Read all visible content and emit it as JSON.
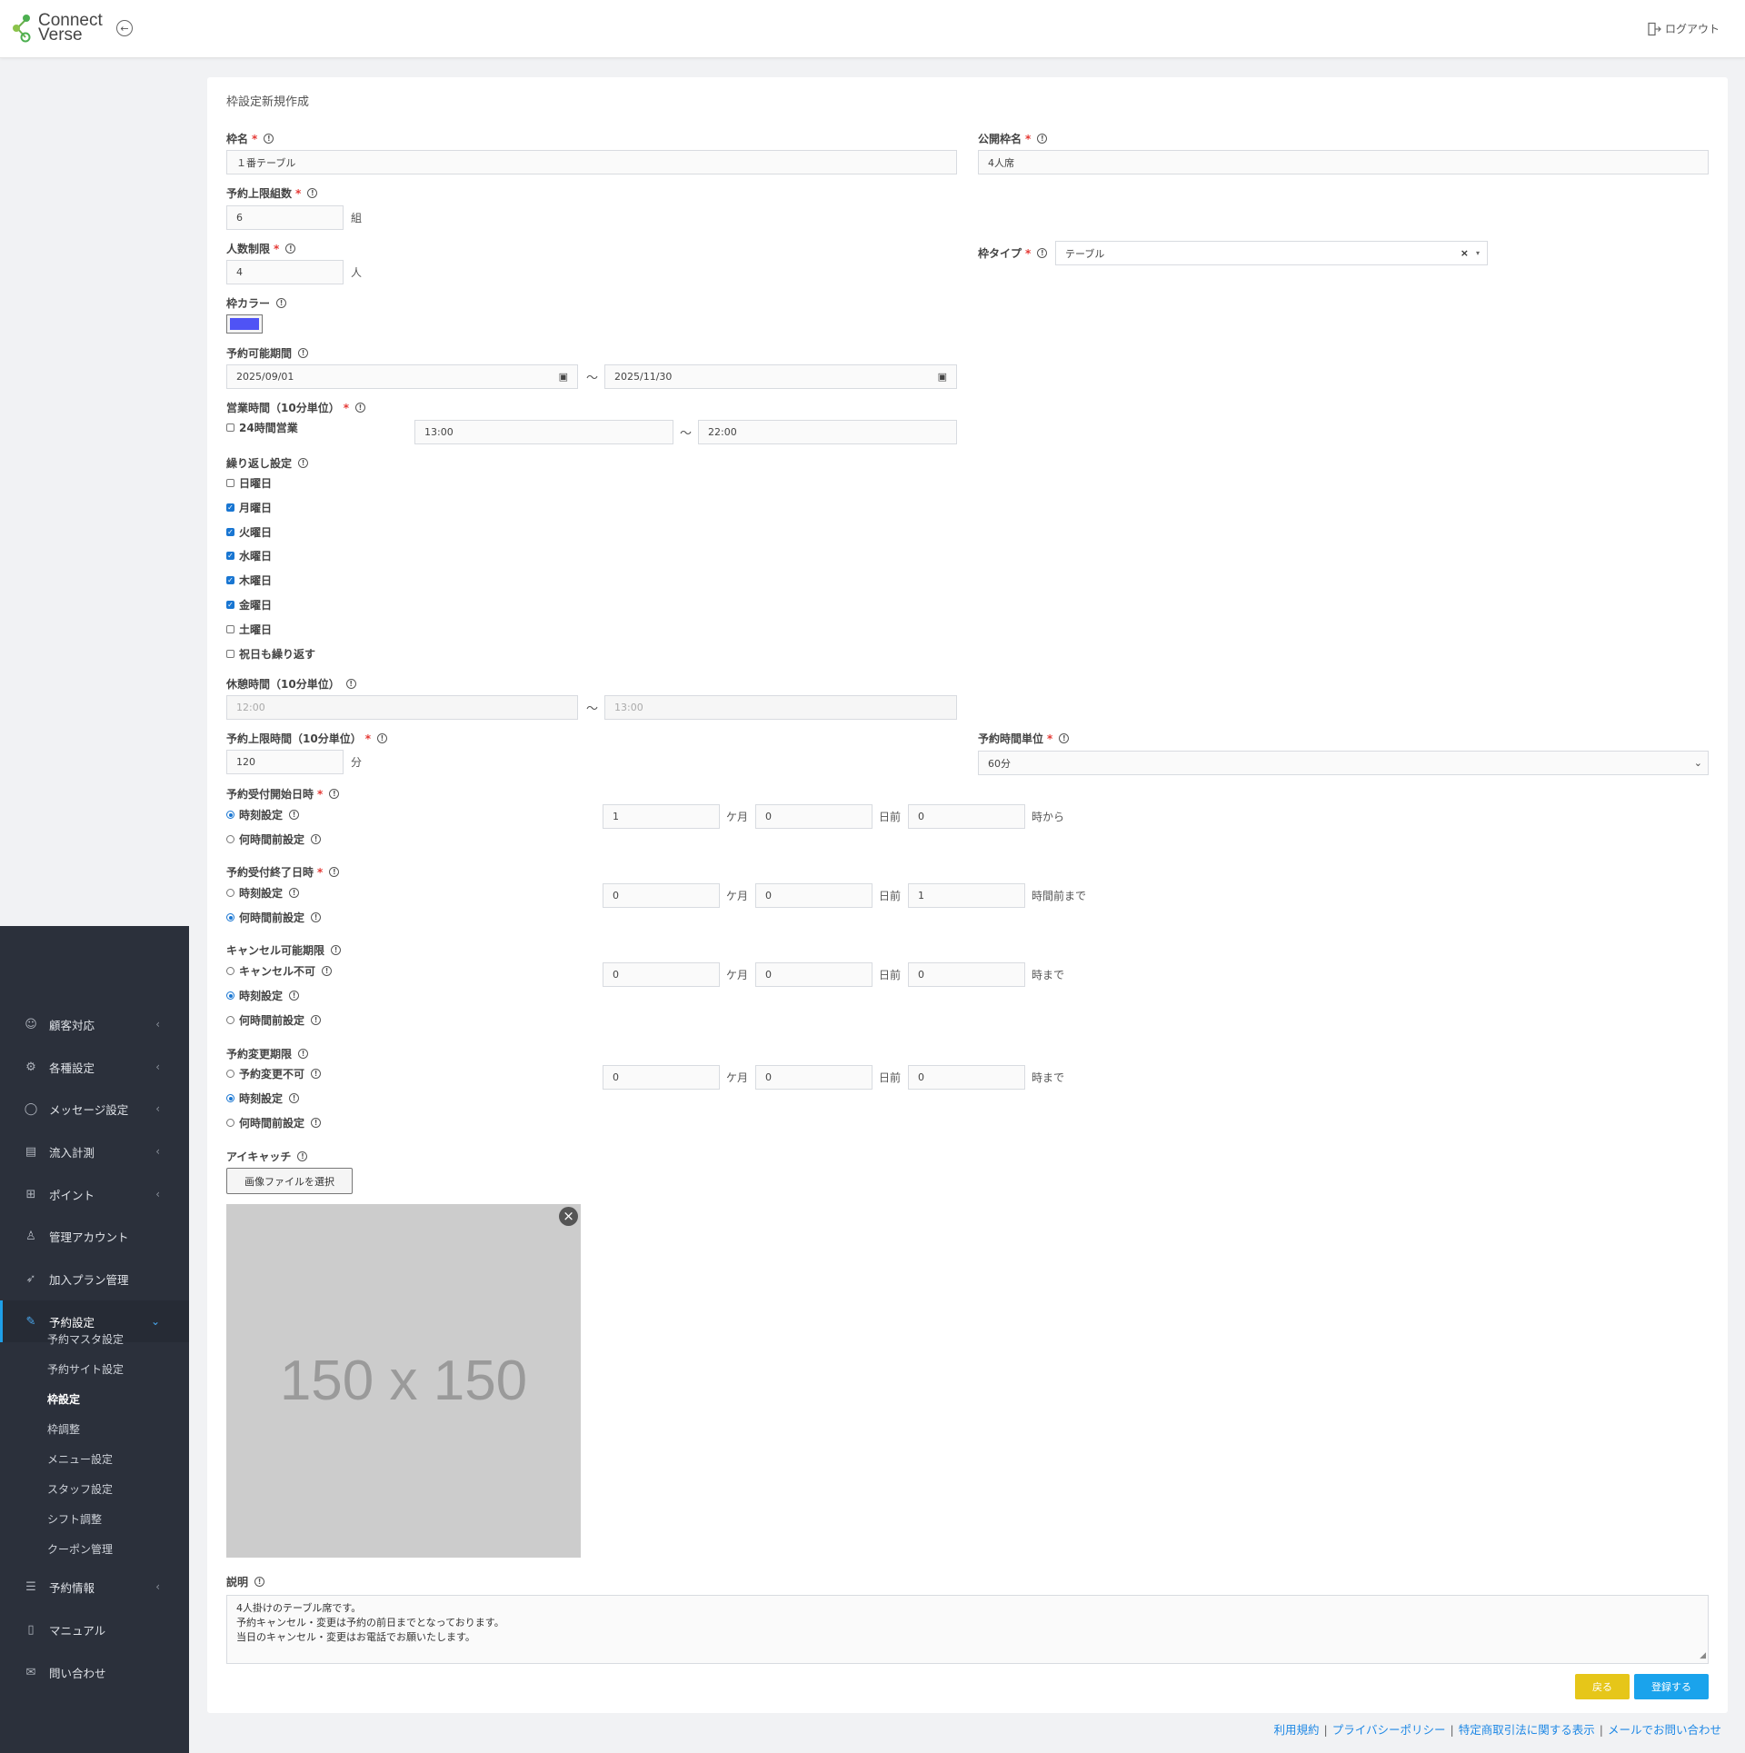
{
  "app": {
    "logo_line1": "Connect",
    "logo_line2": "Verse",
    "logout": "ログアウト"
  },
  "sidebar": {
    "items": [
      {
        "label": "顧客対応",
        "icon": "users-icon"
      },
      {
        "label": "各種設定",
        "icon": "gear-icon"
      },
      {
        "label": "メッセージ設定",
        "icon": "chat-icon"
      },
      {
        "label": "流入計測",
        "icon": "chart-icon"
      },
      {
        "label": "ポイント",
        "icon": "gift-icon"
      },
      {
        "label": "管理アカウント",
        "icon": "user-icon"
      },
      {
        "label": "加入プラン管理",
        "icon": "rocket-icon"
      },
      {
        "label": "予約設定",
        "icon": "pencil-icon"
      }
    ],
    "sub_items": [
      "予約マスタ設定",
      "予約サイト設定",
      "枠設定",
      "枠調整",
      "メニュー設定",
      "スタッフ設定",
      "シフト調整",
      "クーポン管理"
    ],
    "bottom_items": [
      {
        "label": "予約情報",
        "icon": "list-icon"
      },
      {
        "label": "マニュアル",
        "icon": "book-icon"
      },
      {
        "label": "問い合わせ",
        "icon": "mail-icon"
      }
    ]
  },
  "form": {
    "title": "枠設定新規作成",
    "frame_name": {
      "label": "枠名",
      "value": "１番テーブル"
    },
    "public_name": {
      "label": "公開枠名",
      "value": "4人席"
    },
    "max_groups": {
      "label": "予約上限組数",
      "value": "6",
      "unit": "組"
    },
    "people_limit": {
      "label": "人数制限",
      "value": "4",
      "unit": "人"
    },
    "frame_type": {
      "label": "枠タイプ",
      "value": "テーブル"
    },
    "frame_color": {
      "label": "枠カラー",
      "color": "#4f53f5"
    },
    "period": {
      "label": "予約可能期間",
      "from": "2025/09/01",
      "to": "2025/11/30"
    },
    "business_hours": {
      "label": "営業時間（10分単位）",
      "all_day": "24時間営業",
      "from": "13:00",
      "to": "22:00"
    },
    "repeat": {
      "label": "繰り返し設定",
      "days": [
        {
          "label": "日曜日",
          "checked": false
        },
        {
          "label": "月曜日",
          "checked": true
        },
        {
          "label": "火曜日",
          "checked": true
        },
        {
          "label": "水曜日",
          "checked": true
        },
        {
          "label": "木曜日",
          "checked": true
        },
        {
          "label": "金曜日",
          "checked": true
        },
        {
          "label": "土曜日",
          "checked": false
        },
        {
          "label": "祝日も繰り返す",
          "checked": false
        }
      ]
    },
    "break": {
      "label": "休憩時間（10分単位）",
      "from": "12:00",
      "to": "13:00"
    },
    "max_time": {
      "label": "予約上限時間（10分単位）",
      "value": "120",
      "unit": "分"
    },
    "time_unit": {
      "label": "予約時間単位",
      "value": "60分"
    },
    "accept_start": {
      "label": "予約受付開始日時",
      "opt1": "時刻設定",
      "opt2": "何時間前設定",
      "months": "1",
      "days": "0",
      "hours": "0",
      "suffix": "時から"
    },
    "accept_end": {
      "label": "予約受付終了日時",
      "opt1": "時刻設定",
      "opt2": "何時間前設定",
      "months": "0",
      "days": "0",
      "hours": "1",
      "suffix": "時間前まで"
    },
    "cancel": {
      "label": "キャンセル可能期限",
      "opt0": "キャンセル不可",
      "opt1": "時刻設定",
      "opt2": "何時間前設定",
      "months": "0",
      "days": "0",
      "hours": "0",
      "suffix": "時まで"
    },
    "change": {
      "label": "予約変更期限",
      "opt0": "予約変更不可",
      "opt1": "時刻設定",
      "opt2": "何時間前設定",
      "months": "0",
      "days": "0",
      "hours": "0",
      "suffix": "時まで"
    },
    "units": {
      "month": "ケ月",
      "day": "日前"
    },
    "tilde": "〜",
    "eyecatch": {
      "label": "アイキャッチ",
      "button": "画像ファイルを選択",
      "placeholder_text": "150 x 150"
    },
    "description": {
      "label": "説明",
      "line1": "4人掛けのテーブル席です。",
      "line2": "予約キャンセル・変更は予約の前日までとなっております。",
      "line3": "当日のキャンセル・変更はお電話でお願いたします。"
    },
    "buttons": {
      "back": "戻る",
      "submit": "登録する"
    }
  },
  "footer": {
    "links": [
      "利用規約",
      "プライバシーポリシー",
      "特定商取引法に関する表示",
      "メールでお問い合わせ"
    ]
  },
  "colors": {
    "accent": "#1e9fe8",
    "back_button": "#e6c619",
    "submit_button": "#1aa3ec",
    "sidebar_bg": "#2b303b"
  }
}
